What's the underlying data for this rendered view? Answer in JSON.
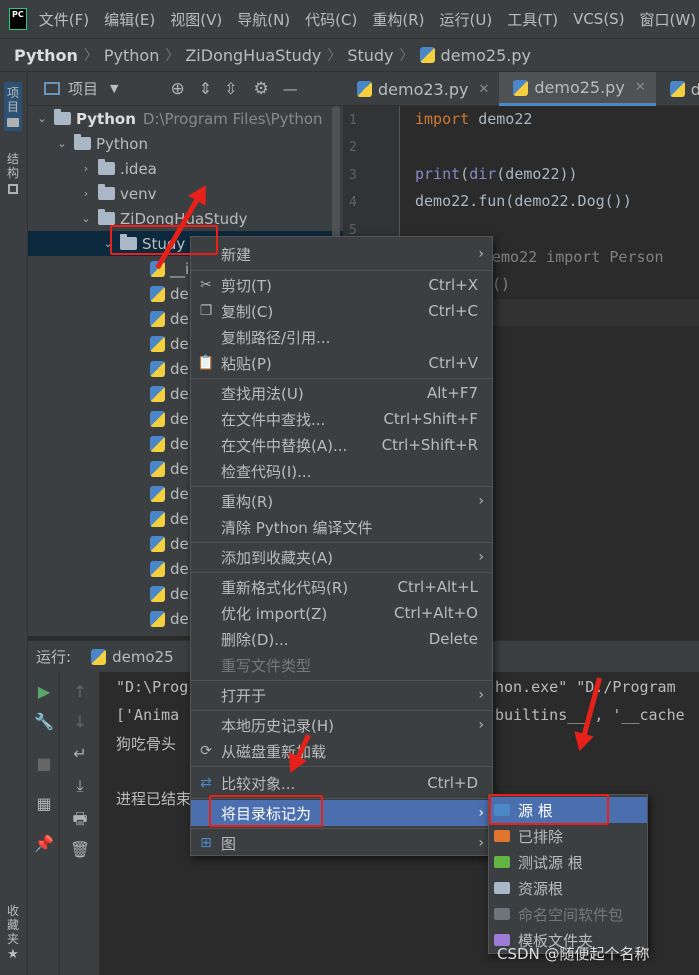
{
  "menubar": {
    "logo": "PC",
    "items": [
      "文件(F)",
      "编辑(E)",
      "视图(V)",
      "导航(N)",
      "代码(C)",
      "重构(R)",
      "运行(U)",
      "工具(T)",
      "VCS(S)",
      "窗口(W)"
    ]
  },
  "breadcrumb": [
    "Python",
    "Python",
    "ZiDongHuaStudy",
    "Study",
    "demo25.py"
  ],
  "left_stripe": {
    "project": "项目",
    "structure": "结构",
    "favorites": "收藏夹"
  },
  "project_panel": {
    "title": "项目",
    "root_name": "Python",
    "root_path": "D:\\Program Files\\Python",
    "items": [
      {
        "label": "Python",
        "type": "folder"
      },
      {
        "label": ".idea",
        "type": "folder"
      },
      {
        "label": "venv",
        "type": "folder"
      },
      {
        "label": "ZiDongHuaStudy",
        "type": "folder"
      },
      {
        "label": "Study",
        "type": "folder"
      },
      {
        "label": "__i",
        "type": "file"
      },
      {
        "label": "de",
        "type": "file"
      },
      {
        "label": "de",
        "type": "file"
      },
      {
        "label": "de",
        "type": "file"
      },
      {
        "label": "de",
        "type": "file"
      },
      {
        "label": "de",
        "type": "file"
      },
      {
        "label": "de",
        "type": "file"
      },
      {
        "label": "de",
        "type": "file"
      },
      {
        "label": "de",
        "type": "file"
      },
      {
        "label": "de",
        "type": "file"
      },
      {
        "label": "de",
        "type": "file"
      },
      {
        "label": "de",
        "type": "file"
      },
      {
        "label": "de",
        "type": "file"
      },
      {
        "label": "de",
        "type": "file"
      },
      {
        "label": "de",
        "type": "file"
      }
    ]
  },
  "editor": {
    "tabs": [
      "demo23.py",
      "demo25.py",
      "dem"
    ],
    "active_tab": "demo25.py",
    "line_numbers": [
      "1",
      "2",
      "3",
      "4",
      "5"
    ],
    "code": {
      "l1_kw": "import",
      "l1_rest": " demo22",
      "l3_print": "print",
      "l3_dir": "dir",
      "l3_rest": "(demo22))",
      "l4": "demo22.fun(demo22.Dog())",
      "l6": "emo22 import Person",
      "l7": "()"
    }
  },
  "run_panel": {
    "label": "运行:",
    "tab": "demo25",
    "output": [
      "\"D:\\Prog",
      "['Anima",
      "狗吃骨头",
      "",
      "进程已结束"
    ],
    "output_right": [
      "hon.exe\" \"D:/Program",
      "builtins__', '__cache"
    ]
  },
  "context_menu": {
    "items": [
      {
        "label": "新建",
        "shortcut": "",
        "submenu": true,
        "icon": ""
      },
      {
        "label": "剪切(T)",
        "shortcut": "Ctrl+X",
        "submenu": false,
        "icon": "✂"
      },
      {
        "label": "复制(C)",
        "shortcut": "Ctrl+C",
        "submenu": false,
        "icon": "❐"
      },
      {
        "label": "复制路径/引用...",
        "shortcut": "",
        "submenu": false,
        "icon": ""
      },
      {
        "label": "粘贴(P)",
        "shortcut": "Ctrl+V",
        "submenu": false,
        "icon": "📋"
      },
      {
        "label": "查找用法(U)",
        "shortcut": "Alt+F7",
        "submenu": false,
        "icon": ""
      },
      {
        "label": "在文件中查找...",
        "shortcut": "Ctrl+Shift+F",
        "submenu": false,
        "icon": ""
      },
      {
        "label": "在文件中替换(A)...",
        "shortcut": "Ctrl+Shift+R",
        "submenu": false,
        "icon": ""
      },
      {
        "label": "检查代码(I)...",
        "shortcut": "",
        "submenu": false,
        "icon": ""
      },
      {
        "label": "重构(R)",
        "shortcut": "",
        "submenu": true,
        "icon": ""
      },
      {
        "label": "清除 Python 编译文件",
        "shortcut": "",
        "submenu": false,
        "icon": ""
      },
      {
        "label": "添加到收藏夹(A)",
        "shortcut": "",
        "submenu": true,
        "icon": ""
      },
      {
        "label": "重新格式化代码(R)",
        "shortcut": "Ctrl+Alt+L",
        "submenu": false,
        "icon": ""
      },
      {
        "label": "优化 import(Z)",
        "shortcut": "Ctrl+Alt+O",
        "submenu": false,
        "icon": ""
      },
      {
        "label": "删除(D)...",
        "shortcut": "Delete",
        "submenu": false,
        "icon": ""
      },
      {
        "label": "重写文件类型",
        "shortcut": "",
        "submenu": false,
        "icon": "",
        "disabled": true
      },
      {
        "label": "打开于",
        "shortcut": "",
        "submenu": true,
        "icon": ""
      },
      {
        "label": "本地历史记录(H)",
        "shortcut": "",
        "submenu": true,
        "icon": ""
      },
      {
        "label": "从磁盘重新加载",
        "shortcut": "",
        "submenu": false,
        "icon": "⟳"
      },
      {
        "label": "比较对象...",
        "shortcut": "Ctrl+D",
        "submenu": false,
        "icon": "⇄"
      },
      {
        "label": "将目录标记为",
        "shortcut": "",
        "submenu": true,
        "icon": "",
        "highlight": true
      },
      {
        "label": "图",
        "shortcut": "",
        "submenu": true,
        "icon": "⊞"
      }
    ]
  },
  "sub_menu": {
    "items": [
      {
        "label": "源 根",
        "color": "#4a88c7",
        "highlight": true
      },
      {
        "label": "已排除",
        "color": "#e0762d"
      },
      {
        "label": "测试源 根",
        "color": "#62b543"
      },
      {
        "label": "资源根",
        "color": "#a9b7c6"
      },
      {
        "label": "命名空间软件包",
        "color": "#6f737a",
        "disabled": true
      },
      {
        "label": "模板文件夹",
        "color": "#9e7cd6"
      }
    ]
  },
  "watermark": "CSDN @随便起个名称",
  "colors": {
    "accent": "#4b6eaf",
    "annotation": "#e8201a",
    "keyword": "#cc7832",
    "builtin": "#8888c6"
  }
}
